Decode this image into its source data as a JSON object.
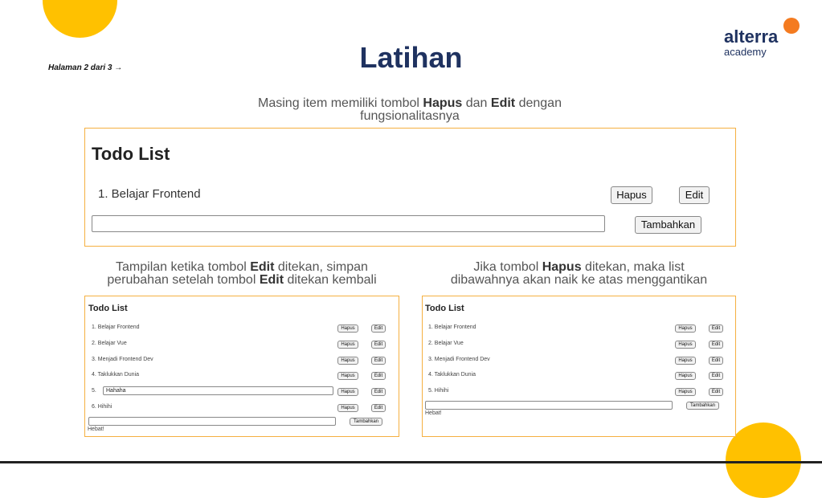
{
  "page_nav": "Halaman 2 dari 3 →",
  "title": "Latihan",
  "brand": {
    "word": "alterra",
    "sub": "academy"
  },
  "caption_top": {
    "pre": "Masing item memiliki tombol ",
    "b1": "Hapus",
    "mid": " dan ",
    "b2": "Edit",
    "post": " dengan",
    "line2": "fungsionalitasnya"
  },
  "caption_left": {
    "l1_pre": "Tampilan ketika tombol ",
    "l1_b": "Edit",
    "l1_post": " ditekan, simpan",
    "l2_pre": "perubahan setelah tombol ",
    "l2_b": "Edit",
    "l2_post": " ditekan kembali"
  },
  "caption_right": {
    "l1_pre": "Jika tombol ",
    "l1_b": "Hapus",
    "l1_post": " ditekan, maka list",
    "l2": "dibawahnya akan naik ke atas menggantikan"
  },
  "main_demo": {
    "title": "Todo List",
    "item": "1. Belajar Frontend",
    "delete": "Hapus",
    "edit": "Edit",
    "input_value": "",
    "add": "Tambahkan"
  },
  "left_demo": {
    "title": "Todo List",
    "items": [
      "1. Belajar Frontend",
      "2. Belajar Vue",
      "3. Menjadi Frontend Dev",
      "4. Taklukkan Dunia",
      "5.",
      "6. Hihihi"
    ],
    "editing_value": "Hahaha",
    "delete": "Hapus",
    "edit": "Edit",
    "add": "Tambahkan",
    "note": "Hebat!"
  },
  "right_demo": {
    "title": "Todo List",
    "items": [
      "1. Belajar Frontend",
      "2. Belajar Vue",
      "3. Menjadi Frontend Dev",
      "4. Taklukkan Dunia",
      "5. Hihihi"
    ],
    "delete": "Hapus",
    "edit": "Edit",
    "add": "Tambahkan",
    "note": "Hebat!"
  }
}
